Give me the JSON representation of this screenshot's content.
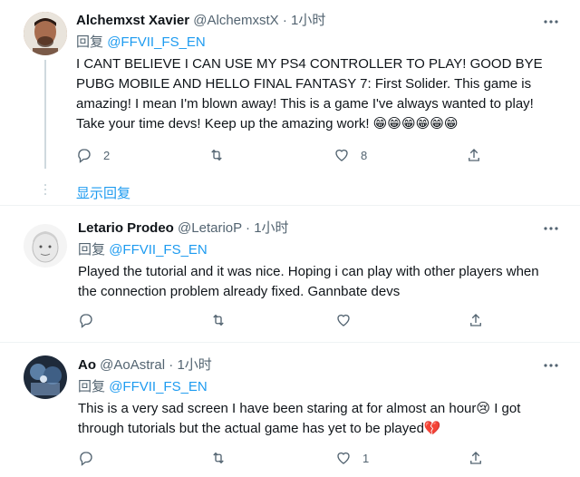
{
  "tweets": [
    {
      "name": "Alchemxst Xavier",
      "handle": "@AlchemxstX",
      "dot": "·",
      "time": "1小时",
      "reply_prefix": "回复",
      "reply_to": "@FFVII_FS_EN",
      "text": "I CANT BELIEVE I CAN USE MY PS4 CONTROLLER TO PLAY! GOOD BYE PUBG MOBILE AND HELLO FINAL FANTASY 7: First Solider. This game is amazing! I mean I'm blown away! This is a game I've always wanted to play! Take your time devs! Keep up the amazing work!",
      "emoji": "😁😁😁😁😁😁",
      "replies": "2",
      "retweets": "",
      "likes": "8",
      "show_replies": "显示回复"
    },
    {
      "name": "Letario Prodeo",
      "handle": "@LetarioP",
      "dot": "·",
      "time": "1小时",
      "reply_prefix": "回复",
      "reply_to": "@FFVII_FS_EN",
      "text": "Played the tutorial and it was nice. Hoping i can play with other players when the connection problem already fixed. Gannbate devs",
      "replies": "",
      "retweets": "",
      "likes": ""
    },
    {
      "name": "Ao",
      "handle": "@AoAstral",
      "dot": "·",
      "time": "1小时",
      "reply_prefix": "回复",
      "reply_to": "@FFVII_FS_EN",
      "text_a": "This is a very sad screen I have been staring at for almost an hour",
      "emoji_a": "😢",
      "text_b": " I got through tutorials but the actual game has yet to be played",
      "emoji_b": "💔",
      "replies": "",
      "retweets": "",
      "likes": "1"
    }
  ],
  "colors": {
    "accent": "#1d9bf0",
    "text": "#0f1419",
    "secondary": "#536471",
    "divider": "#eff3f4"
  },
  "icons": {
    "reply": "reply-icon",
    "retweet": "retweet-icon",
    "like": "heart-icon",
    "share": "share-icon",
    "more": "more-icon"
  }
}
